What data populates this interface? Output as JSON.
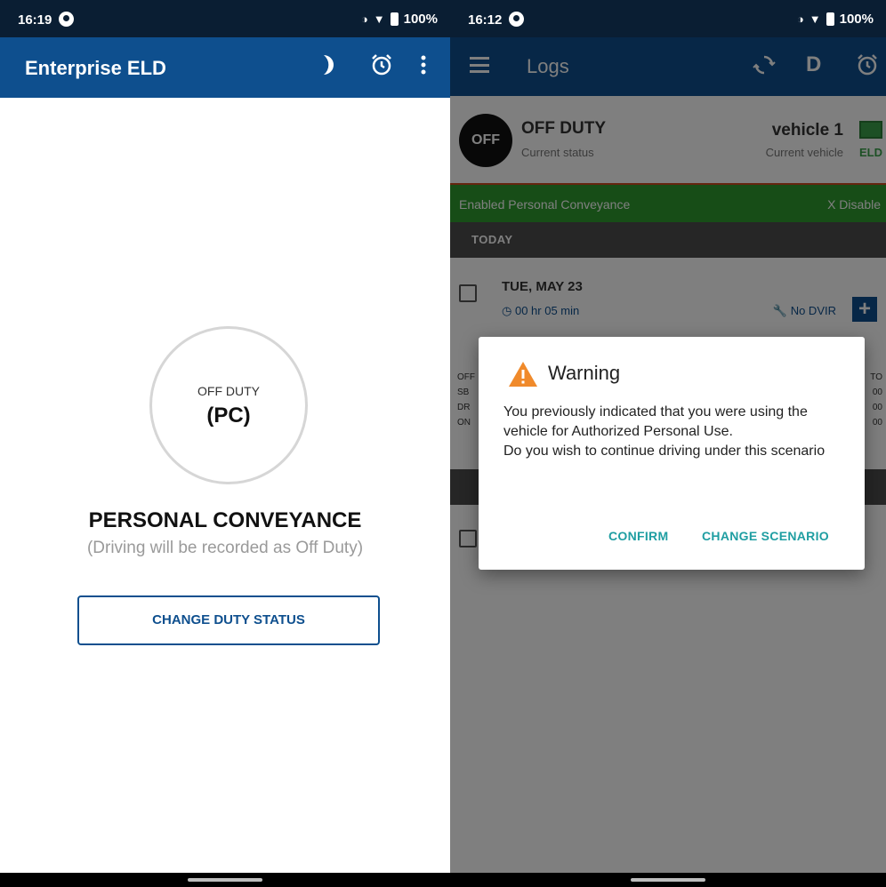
{
  "left_screen": {
    "statusbar": {
      "time": "16:19",
      "battery": "100%"
    },
    "appbar": {
      "title": "Enterprise ELD"
    },
    "duty_circle": {
      "label": "OFF DUTY",
      "value": "(PC)"
    },
    "headline": "PERSONAL CONVEYANCE",
    "subtitle": "(Driving will be recorded as Off Duty)",
    "change_duty_button": "CHANGE DUTY STATUS"
  },
  "right_screen": {
    "statusbar": {
      "time": "16:12",
      "battery": "100%"
    },
    "appbar": {
      "title": "Logs",
      "d_label": "D"
    },
    "status_card": {
      "badge": "OFF",
      "duty": "OFF DUTY",
      "duty_caption": "Current status",
      "vehicle": "vehicle 1",
      "vehicle_caption": "Current vehicle",
      "eld": "ELD"
    },
    "pc_banner": {
      "text": "Enabled Personal Conveyance",
      "disable": "X Disable"
    },
    "today_header": "TODAY",
    "log_entry": {
      "date": "TUE, MAY 23",
      "duration": "00 hr 05 min",
      "dvir": "No DVIR",
      "add": "+"
    },
    "grid_labels_left": [
      "OFF",
      "SB",
      "DR",
      "ON"
    ],
    "grid_labels_right": [
      "TO",
      "00",
      "00",
      "00"
    ],
    "dialog": {
      "title": "Warning",
      "message_1": "You previously indicated that you were using the vehicle for Authorized Personal Use.",
      "message_2": "Do you wish to continue driving under this scenario",
      "confirm": "CONFIRM",
      "change_scenario": "CHANGE SCENARIO"
    }
  },
  "colors": {
    "primary": "#0e4f8e",
    "statusbar": "#0a1e33",
    "banner_green": "#2e9b2e",
    "warning": "#f08a2b",
    "dialog_button": "#1f9ea2"
  }
}
